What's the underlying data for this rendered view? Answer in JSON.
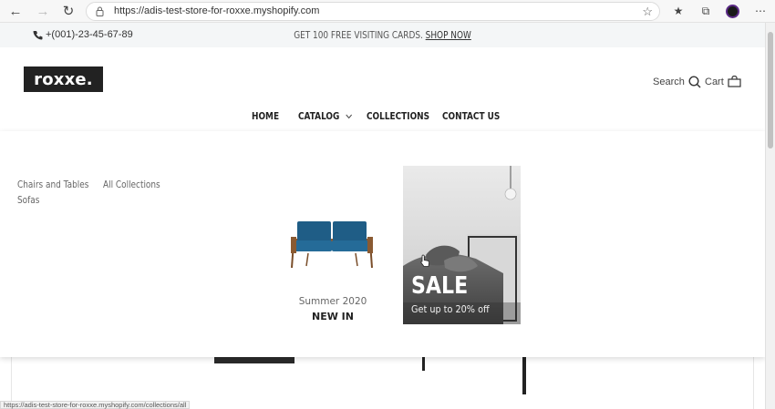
{
  "browser": {
    "url": "https://adis-test-store-for-roxxe.myshopify.com",
    "status_url": "https://adis-test-store-for-roxxe.myshopify.com/collections/all"
  },
  "announcement": {
    "phone": "+(001)-23-45-67-89",
    "promo_text": "GET 100 FREE VISITING CARDS.",
    "promo_link": "SHOP NOW"
  },
  "header": {
    "logo": "roxxe.",
    "search_label": "Search",
    "cart_label": "Cart"
  },
  "nav": {
    "items": [
      {
        "label": "HOME"
      },
      {
        "label": "CATALOG"
      },
      {
        "label": "COLLECTIONS"
      },
      {
        "label": "CONTACT US"
      }
    ]
  },
  "mega_menu": {
    "links": [
      {
        "label": "Chairs and Tables"
      },
      {
        "label": "All Collections"
      },
      {
        "label": "Sofas"
      }
    ],
    "promo_new": {
      "subtitle": "Summer 2020",
      "title": "NEW IN"
    },
    "promo_sale": {
      "title": "SALE",
      "subtitle": "Get up to 20% off"
    }
  },
  "colors": {
    "accent": "#222222",
    "sofa": "#1f5d86",
    "announce_bg": "#f4f6f7"
  }
}
